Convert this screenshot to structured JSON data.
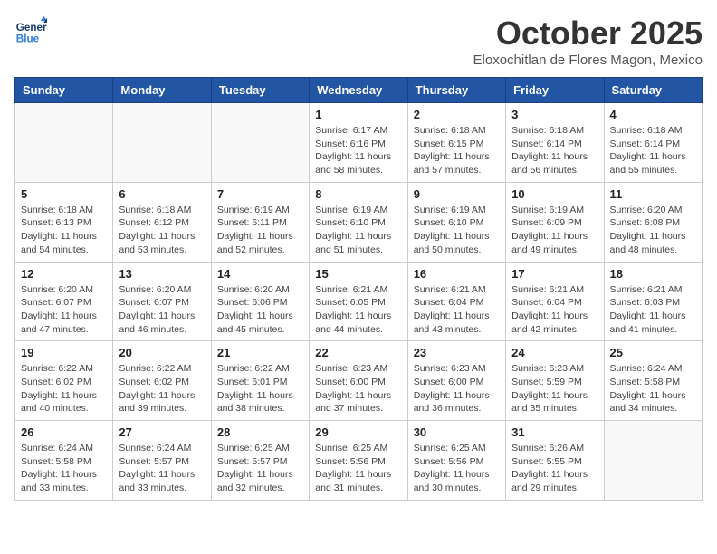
{
  "header": {
    "logo_line1": "General",
    "logo_line2": "Blue",
    "month": "October 2025",
    "location": "Eloxochitlan de Flores Magon, Mexico"
  },
  "weekdays": [
    "Sunday",
    "Monday",
    "Tuesday",
    "Wednesday",
    "Thursday",
    "Friday",
    "Saturday"
  ],
  "weeks": [
    [
      {
        "day": "",
        "info": ""
      },
      {
        "day": "",
        "info": ""
      },
      {
        "day": "",
        "info": ""
      },
      {
        "day": "1",
        "info": "Sunrise: 6:17 AM\nSunset: 6:16 PM\nDaylight: 11 hours and 58 minutes."
      },
      {
        "day": "2",
        "info": "Sunrise: 6:18 AM\nSunset: 6:15 PM\nDaylight: 11 hours and 57 minutes."
      },
      {
        "day": "3",
        "info": "Sunrise: 6:18 AM\nSunset: 6:14 PM\nDaylight: 11 hours and 56 minutes."
      },
      {
        "day": "4",
        "info": "Sunrise: 6:18 AM\nSunset: 6:14 PM\nDaylight: 11 hours and 55 minutes."
      }
    ],
    [
      {
        "day": "5",
        "info": "Sunrise: 6:18 AM\nSunset: 6:13 PM\nDaylight: 11 hours and 54 minutes."
      },
      {
        "day": "6",
        "info": "Sunrise: 6:18 AM\nSunset: 6:12 PM\nDaylight: 11 hours and 53 minutes."
      },
      {
        "day": "7",
        "info": "Sunrise: 6:19 AM\nSunset: 6:11 PM\nDaylight: 11 hours and 52 minutes."
      },
      {
        "day": "8",
        "info": "Sunrise: 6:19 AM\nSunset: 6:10 PM\nDaylight: 11 hours and 51 minutes."
      },
      {
        "day": "9",
        "info": "Sunrise: 6:19 AM\nSunset: 6:10 PM\nDaylight: 11 hours and 50 minutes."
      },
      {
        "day": "10",
        "info": "Sunrise: 6:19 AM\nSunset: 6:09 PM\nDaylight: 11 hours and 49 minutes."
      },
      {
        "day": "11",
        "info": "Sunrise: 6:20 AM\nSunset: 6:08 PM\nDaylight: 11 hours and 48 minutes."
      }
    ],
    [
      {
        "day": "12",
        "info": "Sunrise: 6:20 AM\nSunset: 6:07 PM\nDaylight: 11 hours and 47 minutes."
      },
      {
        "day": "13",
        "info": "Sunrise: 6:20 AM\nSunset: 6:07 PM\nDaylight: 11 hours and 46 minutes."
      },
      {
        "day": "14",
        "info": "Sunrise: 6:20 AM\nSunset: 6:06 PM\nDaylight: 11 hours and 45 minutes."
      },
      {
        "day": "15",
        "info": "Sunrise: 6:21 AM\nSunset: 6:05 PM\nDaylight: 11 hours and 44 minutes."
      },
      {
        "day": "16",
        "info": "Sunrise: 6:21 AM\nSunset: 6:04 PM\nDaylight: 11 hours and 43 minutes."
      },
      {
        "day": "17",
        "info": "Sunrise: 6:21 AM\nSunset: 6:04 PM\nDaylight: 11 hours and 42 minutes."
      },
      {
        "day": "18",
        "info": "Sunrise: 6:21 AM\nSunset: 6:03 PM\nDaylight: 11 hours and 41 minutes."
      }
    ],
    [
      {
        "day": "19",
        "info": "Sunrise: 6:22 AM\nSunset: 6:02 PM\nDaylight: 11 hours and 40 minutes."
      },
      {
        "day": "20",
        "info": "Sunrise: 6:22 AM\nSunset: 6:02 PM\nDaylight: 11 hours and 39 minutes."
      },
      {
        "day": "21",
        "info": "Sunrise: 6:22 AM\nSunset: 6:01 PM\nDaylight: 11 hours and 38 minutes."
      },
      {
        "day": "22",
        "info": "Sunrise: 6:23 AM\nSunset: 6:00 PM\nDaylight: 11 hours and 37 minutes."
      },
      {
        "day": "23",
        "info": "Sunrise: 6:23 AM\nSunset: 6:00 PM\nDaylight: 11 hours and 36 minutes."
      },
      {
        "day": "24",
        "info": "Sunrise: 6:23 AM\nSunset: 5:59 PM\nDaylight: 11 hours and 35 minutes."
      },
      {
        "day": "25",
        "info": "Sunrise: 6:24 AM\nSunset: 5:58 PM\nDaylight: 11 hours and 34 minutes."
      }
    ],
    [
      {
        "day": "26",
        "info": "Sunrise: 6:24 AM\nSunset: 5:58 PM\nDaylight: 11 hours and 33 minutes."
      },
      {
        "day": "27",
        "info": "Sunrise: 6:24 AM\nSunset: 5:57 PM\nDaylight: 11 hours and 33 minutes."
      },
      {
        "day": "28",
        "info": "Sunrise: 6:25 AM\nSunset: 5:57 PM\nDaylight: 11 hours and 32 minutes."
      },
      {
        "day": "29",
        "info": "Sunrise: 6:25 AM\nSunset: 5:56 PM\nDaylight: 11 hours and 31 minutes."
      },
      {
        "day": "30",
        "info": "Sunrise: 6:25 AM\nSunset: 5:56 PM\nDaylight: 11 hours and 30 minutes."
      },
      {
        "day": "31",
        "info": "Sunrise: 6:26 AM\nSunset: 5:55 PM\nDaylight: 11 hours and 29 minutes."
      },
      {
        "day": "",
        "info": ""
      }
    ]
  ]
}
